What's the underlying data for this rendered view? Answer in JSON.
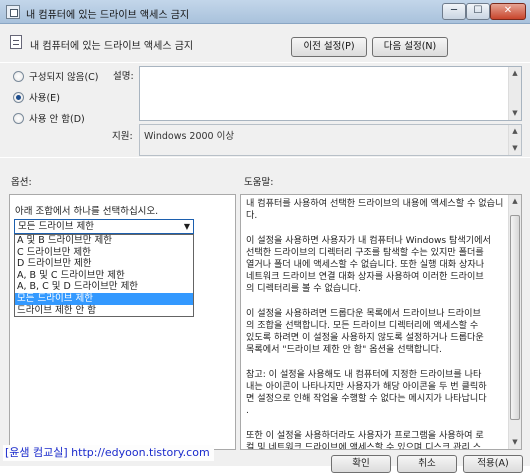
{
  "window": {
    "title": "내 컴퓨터에 있는 드라이브 액세스 금지",
    "minimize": "─",
    "maximize": "☐",
    "close": "✕"
  },
  "header": {
    "policy_name": "내 컴퓨터에 있는 드라이브 액세스 금지",
    "prev_button": "이전 설정(P)",
    "next_button": "다음 설정(N)"
  },
  "state": {
    "options": [
      {
        "label": "구성되지 않음(C)",
        "checked": false
      },
      {
        "label": "사용(E)",
        "checked": true
      },
      {
        "label": "사용 안 함(D)",
        "checked": false
      }
    ]
  },
  "comment": {
    "label": "설명:",
    "value": ""
  },
  "supported": {
    "label": "지원:",
    "value": "Windows 2000 이상"
  },
  "options_panel": {
    "label": "옵션:",
    "instruction": "아래 조합에서 하나를 선택하십시오.",
    "dropdown_value": "모든 드라이브 제한",
    "dropdown_items": [
      "A 및 B 드라이브만 제한",
      "C 드라이브만 제한",
      "D 드라이브만 제한",
      "A, B 및 C 드라이브만 제한",
      "A, B, C 및 D 드라이브만 제한",
      "모든 드라이브 제한",
      "드라이브 제한 안 함"
    ],
    "dropdown_selected_index": 5
  },
  "help_panel": {
    "label": "도움말:",
    "paragraphs": [
      "내 컴퓨터를 사용하여 선택한 드라이브의 내용에 액세스할 수 없습니다.",
      "이 설정을 사용하면 사용자가 내 컴퓨터나 Windows 탐색기에서\n선택한 드라이브의 디렉터리 구조를 탐색할 수는 있지만 폴더를\n열거나 폴더 내에 액세스할 수 없습니다. 또한 실행 대화 상자나\n네트워크 드라이브 연결 대화 상자를 사용하여 이러한 드라이브\n의 디렉터리를 볼 수 없습니다.",
      "이 설정을 사용하려면 드롭다운 목록에서 드라이브나 드라이브\n의 조합을 선택합니다. 모든 드라이브 디렉터리에 액세스할 수\n있도록 하려면 이 설정을 사용하지 않도록 설정하거나 드롭다운\n목록에서 \"드라이브 제한 안 함\" 옵션을 선택합니다.",
      "참고: 이 설정을 사용해도 내 컴퓨터에 지정한 드라이브를 나타\n내는 아이콘이 나타나지만 사용자가 해당 아이콘을 두 번 클릭하\n면 설정으로 인해 작업을 수행할 수 없다는 메시지가 나타납니다\n.",
      "또한 이 설정을 사용하더라도 사용자가 프로그램을 사용하여 로\n컬 및 네트워크 드라이브에 액세스할 수 있으며 디스크 관리 스"
    ]
  },
  "footer": {
    "ok": "확인",
    "cancel": "취소",
    "apply": "적용(A)"
  },
  "watermark": "[윤샘 컴교실] http://edyoon.tistory.com"
}
